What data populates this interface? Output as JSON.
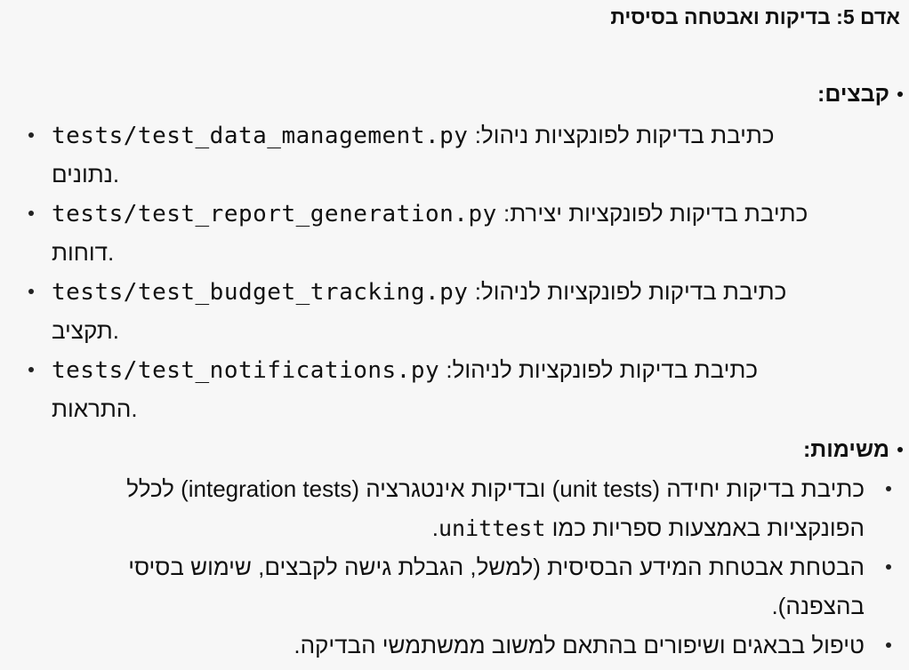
{
  "heading": "אדם 5: בדיקות ואבטחה בסיסית",
  "files_section": {
    "title": "קבצים:",
    "items": [
      {
        "path": "tests/test_data_management.py",
        "desc1": ":כתיבת בדיקות לפונקציות ניהול",
        "desc2": "נתונים."
      },
      {
        "path": "tests/test_report_generation.py",
        "desc1": ":כתיבת בדיקות לפונקציות יצירת",
        "desc2": "דוחות."
      },
      {
        "path": "tests/test_budget_tracking.py",
        "desc1": ":כתיבת בדיקות לפונקציות לניהול",
        "desc2": "תקציב."
      },
      {
        "path": "tests/test_notifications.py",
        "desc1": ":כתיבת בדיקות לפונקציות לניהול",
        "desc2": "התראות."
      }
    ]
  },
  "tasks_section": {
    "title": "משימות:",
    "items": [
      {
        "line1": "כתיבת בדיקות יחידה (unit tests) ובדיקות אינטגרציה (integration tests) לכלל",
        "line2_text": "הפונקציות באמצעות ספריות כמו ",
        "line2_code": "unittest",
        "line2_end": "."
      },
      {
        "line1": "הבטחת אבטחת המידע הבסיסית (למשל, הגבלת גישה לקבצים, שימוש בסיסי",
        "line2_text": "בהצפנה).",
        "line2_code": "",
        "line2_end": ""
      },
      {
        "line1": "טיפול בבאגים ושיפורים בהתאם למשוב ממשתמשי הבדיקה.",
        "line2_text": "",
        "line2_code": "",
        "line2_end": ""
      }
    ]
  }
}
